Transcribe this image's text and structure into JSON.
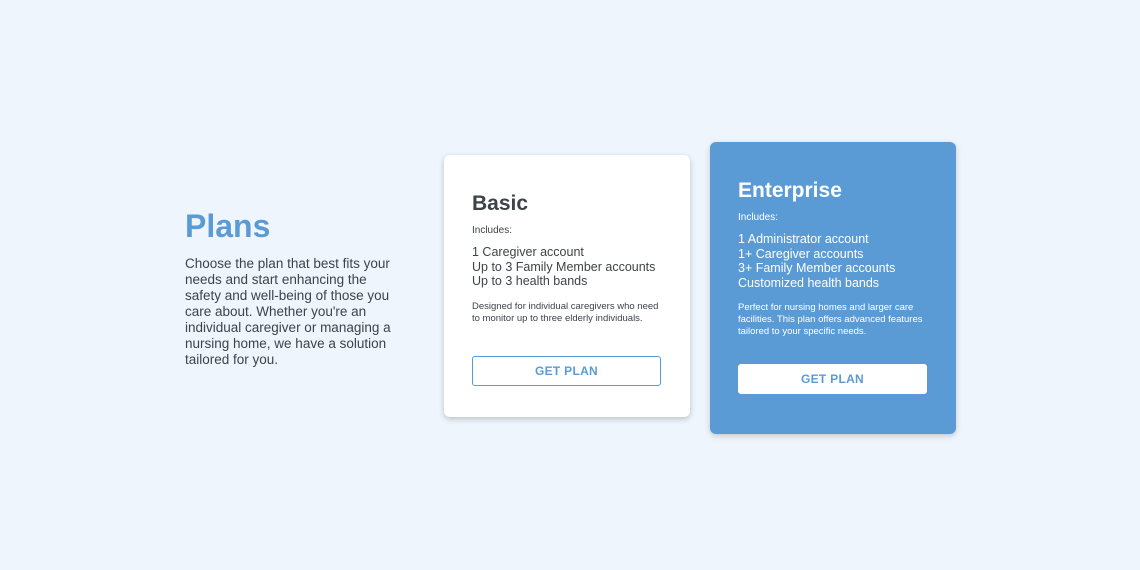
{
  "intro": {
    "title": "Plans",
    "description": "Choose the plan that best fits your needs and start enhancing the safety and well-being of those you care about. Whether you're an individual caregiver or managing a nursing home, we have a solution tailored for you."
  },
  "plans": [
    {
      "name": "Basic",
      "includes_label": "Includes:",
      "features": [
        "1 Caregiver account",
        "Up to 3 Family Member accounts",
        "Up to 3 health bands"
      ],
      "description": "Designed for individual caregivers who need to monitor up to three elderly individuals.",
      "button_label": "GET PLAN"
    },
    {
      "name": "Enterprise",
      "includes_label": "Includes:",
      "features": [
        "1 Administrator account",
        "1+ Caregiver accounts",
        "3+ Family Member accounts",
        "Customized health bands"
      ],
      "description": "Perfect for nursing homes and larger care facilities. This plan offers advanced features tailored to your specific needs.",
      "button_label": "GET PLAN"
    }
  ],
  "colors": {
    "background": "#eef5fc",
    "accent": "#5b9bd5",
    "text": "#3d4349",
    "card": "#ffffff"
  }
}
